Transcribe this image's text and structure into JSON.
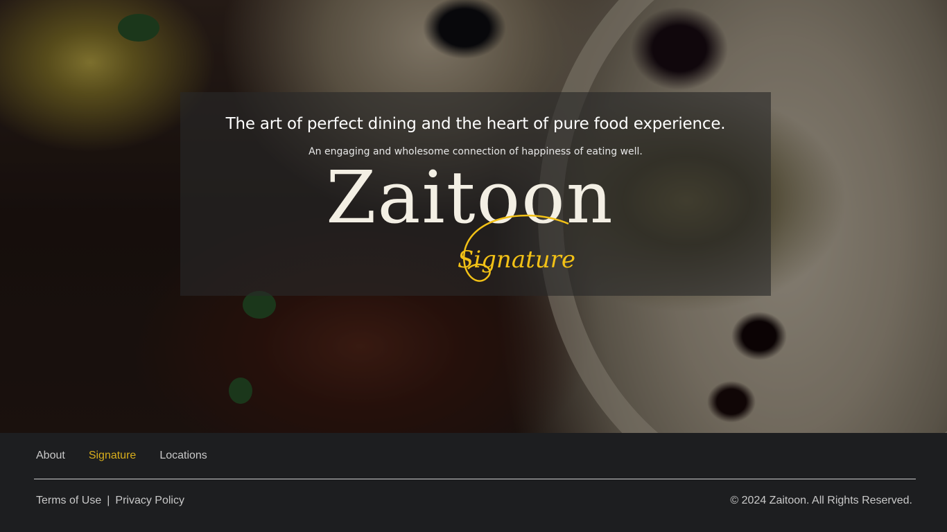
{
  "hero": {
    "headline": "The art of perfect dining and the heart of pure food experience.",
    "subheadline": "An engaging and wholesome connection of happiness of eating well.",
    "brand_name": "Zaitoon",
    "brand_subtitle": "Signature",
    "accent_color": "#f2c116"
  },
  "footer": {
    "nav": [
      {
        "label": "About"
      },
      {
        "label": "Signature",
        "active": true
      },
      {
        "label": "Locations"
      }
    ],
    "terms_label": "Terms of Use",
    "separator": "|",
    "privacy_label": "Privacy Policy",
    "copyright": "© 2024 Zaitoon. All Rights Reserved.",
    "active_color": "#d8ae1c"
  }
}
